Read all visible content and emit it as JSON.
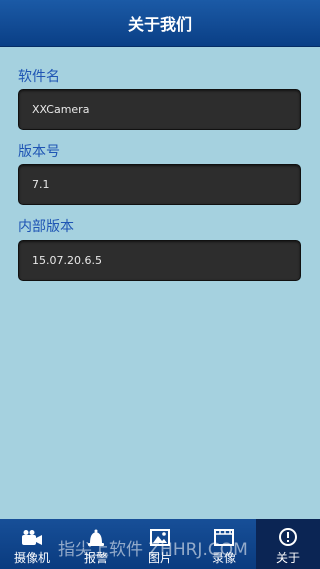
{
  "header": {
    "title": "关于我们"
  },
  "fields": [
    {
      "label": "软件名",
      "value": "XXCamera"
    },
    {
      "label": "版本号",
      "value": "7.1"
    },
    {
      "label": "内部版本",
      "value": "15.07.20.6.5"
    }
  ],
  "tabs": [
    {
      "label": "摄像机",
      "icon": "camera-icon"
    },
    {
      "label": "报警",
      "icon": "alarm-icon"
    },
    {
      "label": "图片",
      "icon": "picture-icon"
    },
    {
      "label": "录像",
      "icon": "video-icon"
    },
    {
      "label": "关于",
      "icon": "info-icon",
      "active": true
    }
  ],
  "watermark": "指尖上软件 ZHHRJ.COM"
}
